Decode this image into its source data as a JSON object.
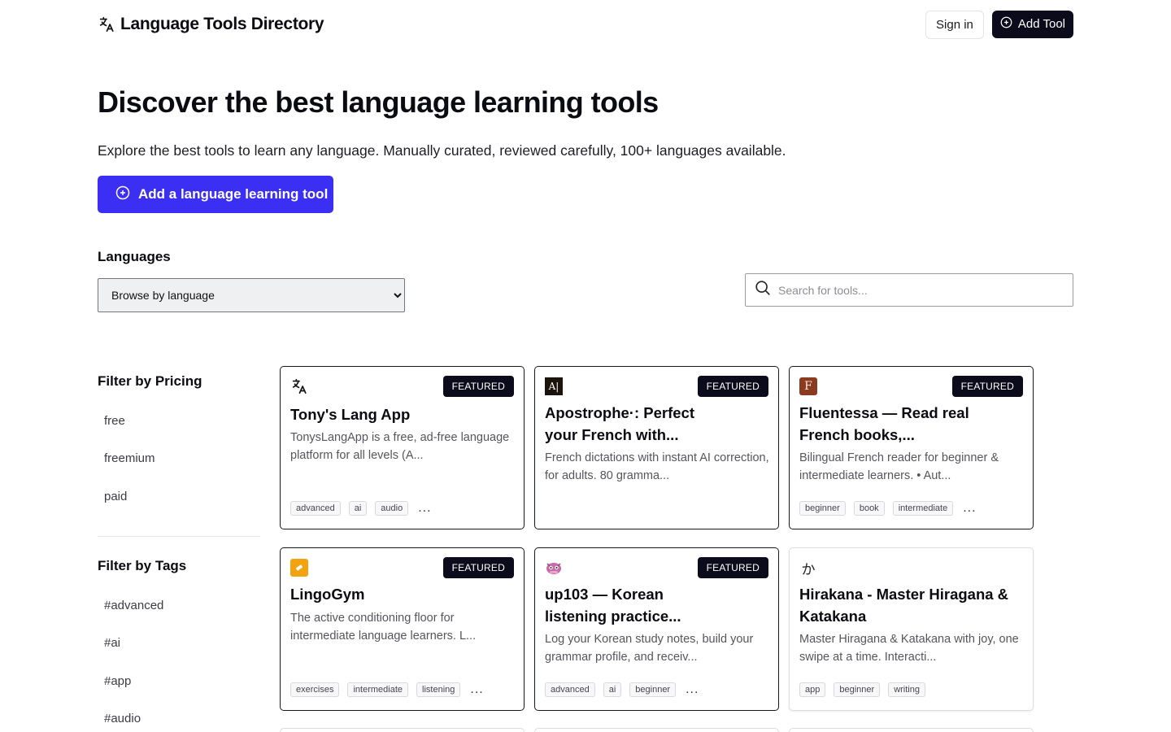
{
  "header": {
    "brand_title": "Language Tools Directory",
    "signin_label": "Sign in",
    "addtool_label": "Add Tool"
  },
  "hero": {
    "title": "Discover the best language learning tools",
    "subtitle": "Explore the best tools to learn any language. Manually curated, reviewed carefully, 100+ languages available.",
    "cta_label": "Add a language learning tool"
  },
  "languages": {
    "label": "Languages",
    "select_value": "Browse by language"
  },
  "search": {
    "placeholder": "Search for tools..."
  },
  "sidebar": {
    "pricing_title": "Filter by Pricing",
    "pricing": [
      "free",
      "freemium",
      "paid"
    ],
    "tags_title": "Filter by Tags",
    "tags": [
      "#advanced",
      "#ai",
      "#app",
      "#audio"
    ]
  },
  "cards": [
    {
      "title": "Tony's Lang App",
      "desc": "TonysLangApp is a free, ad-free language platform for all levels (A...",
      "badge": "FEATURED",
      "tags": [
        "advanced",
        "ai",
        "audio"
      ],
      "more": "...",
      "logo": "translate-icon"
    },
    {
      "title": "Apostrophe·: Perfect your French with...",
      "desc": "French dictations with instant AI correction, for adults. 80 gramma...",
      "badge": "FEATURED",
      "tags": [],
      "more": "",
      "logo_text": "A|"
    },
    {
      "title": "Fluentessa — Read real French books,...",
      "desc": "Bilingual French reader for beginner & intermediate learners. • Aut...",
      "badge": "FEATURED",
      "tags": [
        "beginner",
        "book",
        "intermediate"
      ],
      "more": "...",
      "logo_text": "F"
    },
    {
      "title": "LingoGym",
      "desc": "The active conditioning floor for intermediate language learners. L...",
      "badge": "FEATURED",
      "tags": [
        "exercises",
        "intermediate",
        "listening"
      ],
      "more": "...",
      "logo": "lingogym-logo"
    },
    {
      "title": "up103 — Korean listening practice...",
      "desc": "Log your Korean study notes, build your grammar profile, and receiv...",
      "badge": "FEATURED",
      "tags": [
        "advanced",
        "ai",
        "beginner"
      ],
      "more": "...",
      "logo": "mascot-logo"
    },
    {
      "title": "Hirakana - Master Hiragana & Katakana",
      "desc": "Master Hiragana & Katakana with joy, one swipe at a time. Interacti...",
      "badge": "",
      "tags": [
        "app",
        "beginner",
        "writing"
      ],
      "more": "",
      "logo_text": "か"
    }
  ],
  "colors": {
    "primary": "#3a2ff2",
    "dark": "#0b0b1c",
    "muted_text": "#55555e"
  }
}
